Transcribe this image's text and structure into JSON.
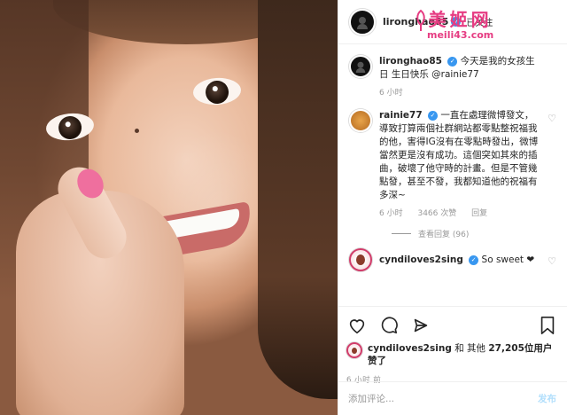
{
  "header": {
    "username": "lironghao85",
    "follow_state": "已关注",
    "more_icon": "ellipsis-icon"
  },
  "watermark": {
    "title": "美姬网",
    "url": "meili43.com"
  },
  "caption": {
    "username": "lironghao85",
    "text": "今天是我的女孩生日 生日快乐 @rainie77",
    "time": "6 小时"
  },
  "comments": [
    {
      "username": "rainie77",
      "text": "一直在處理微博發文，導致打算兩個社群網站都零點整祝福我的他，害得IG沒有在零點時發出，微博當然更是沒有成功。這個突如其來的插曲，破壞了他守時的計畫。但是不管幾點發，甚至不發，我都知道他的祝福有多深~",
      "time": "6 小时",
      "likes": "3466 次赞",
      "reply": "回复",
      "view_replies": "查看回复 (96)"
    },
    {
      "username": "cyndiloves2sing",
      "text": "So sweet ❤",
      "time": ""
    }
  ],
  "actions": {
    "like": "heart-icon",
    "comment": "comment-icon",
    "share": "share-icon",
    "save": "bookmark-icon"
  },
  "likes": {
    "user": "cyndiloves2sing",
    "conj": "和 其他",
    "count": "27,205",
    "suffix": "位用户赞了"
  },
  "timestamp": "6 小时 前",
  "add_comment": {
    "placeholder": "添加评论...",
    "post_label": "发布"
  }
}
